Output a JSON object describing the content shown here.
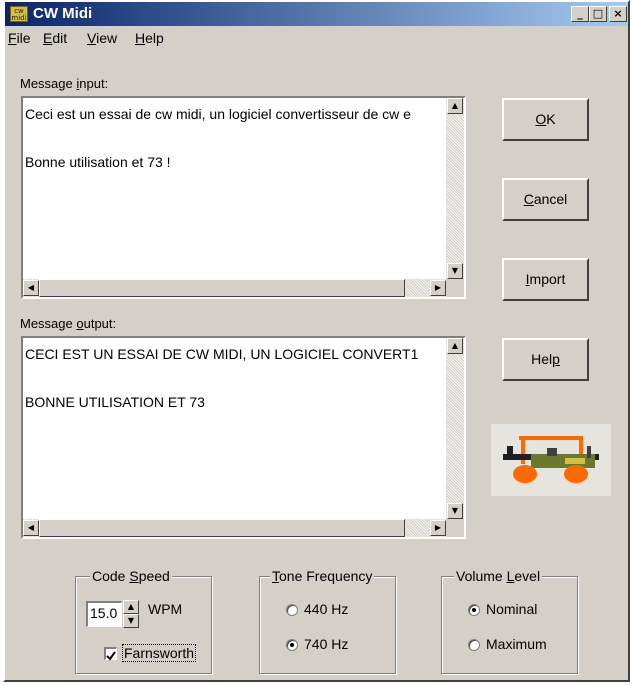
{
  "window": {
    "title": "CW Midi",
    "icon_label": "cw midi"
  },
  "titlebar_buttons": {
    "minimize": "_",
    "maximize": "□",
    "close": "×"
  },
  "menu": [
    {
      "label": "File",
      "accel": "F",
      "rest": "ile"
    },
    {
      "label": "Edit",
      "accel": "E",
      "rest": "dit"
    },
    {
      "label": "View",
      "accel": "V",
      "rest": "iew"
    },
    {
      "label": "Help",
      "accel": "H",
      "rest": "elp"
    }
  ],
  "input": {
    "label_pre": "Message ",
    "label_accel": "i",
    "label_post": "nput:",
    "text": "Ceci est un essai de cw midi, un logiciel convertisseur de cw e\n\nBonne utilisation et 73 !"
  },
  "output": {
    "label_pre": "Message ",
    "label_accel": "o",
    "label_post": "utput:",
    "text": "CECI EST UN ESSAI DE CW MIDI, UN LOGICIEL CONVERT1\n\nBONNE UTILISATION ET 73"
  },
  "buttons": {
    "ok": {
      "accel": "O",
      "rest": "K"
    },
    "cancel": {
      "accel": "C",
      "rest": "ancel"
    },
    "import": {
      "accel": "I",
      "rest": "mport"
    },
    "help": {
      "pre": "Hel",
      "accel": "p",
      "rest": ""
    }
  },
  "code_speed": {
    "title_pre": "Code ",
    "title_accel": "S",
    "title_post": "peed",
    "value": "15.0",
    "unit": "WPM",
    "farnsworth_label": "Farnsworth",
    "farnsworth_checked": true
  },
  "tone_frequency": {
    "title_accel": "T",
    "title_post": "one Frequency",
    "options": [
      "440 Hz",
      "740 Hz"
    ],
    "selected": "740 Hz"
  },
  "volume_level": {
    "title_pre": "Volume ",
    "title_accel": "L",
    "title_post": "evel",
    "options": [
      "Nominal",
      "Maximum"
    ],
    "selected": "Nominal"
  },
  "colors": {
    "title_start": "#0a246a",
    "title_end": "#a6caf0",
    "face": "#d4d0c8",
    "note": "#ff6a00"
  },
  "icons": [
    "app-icon",
    "telegraph-key-icon",
    "radio-icon",
    "checkbox-icon",
    "scroll-arrow-icon"
  ]
}
